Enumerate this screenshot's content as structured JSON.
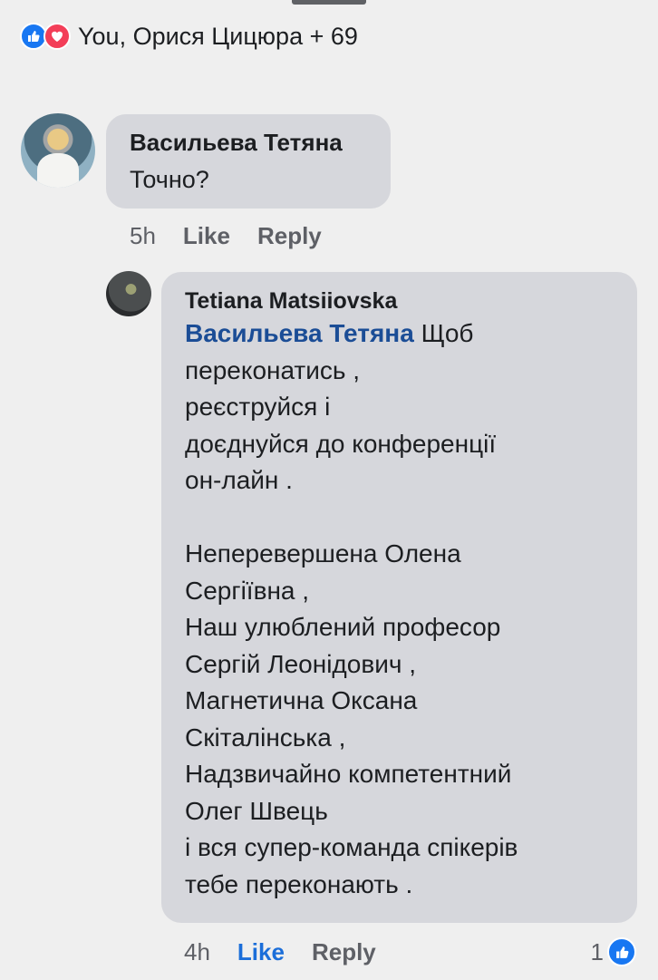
{
  "reactions": {
    "text": "You, Орися Цицюра + 69",
    "icons": [
      "like-icon",
      "love-icon"
    ],
    "like_color": "#1877f2",
    "love_color": "#f33e58"
  },
  "comment": {
    "author": "Васильева Тетяна",
    "text": "Точно?",
    "time": "5h",
    "like_label": "Like",
    "reply_label": "Reply"
  },
  "reply": {
    "author": "Tetiana Matsiiovska",
    "mention": "Васильева Тетяна",
    "lines": [
      " Щоб",
      "переконатись ,",
      "реєструйся і",
      "доєднуйся до конференції",
      "он-лайн .",
      "",
      "Неперевершена Олена",
      "Сергіївна ,",
      "Наш улюблений професор",
      "Сергій Леонідович ,",
      "Магнетична Оксана",
      "Скіталінська ,",
      "Надзвичайно компетентний",
      "Олег Швець",
      "і вся супер-команда спікерів",
      "тебе переконають ."
    ],
    "time": "4h",
    "like_label": "Like",
    "reply_label": "Reply",
    "like_count": "1",
    "liked_color": "#1b6ed9"
  }
}
